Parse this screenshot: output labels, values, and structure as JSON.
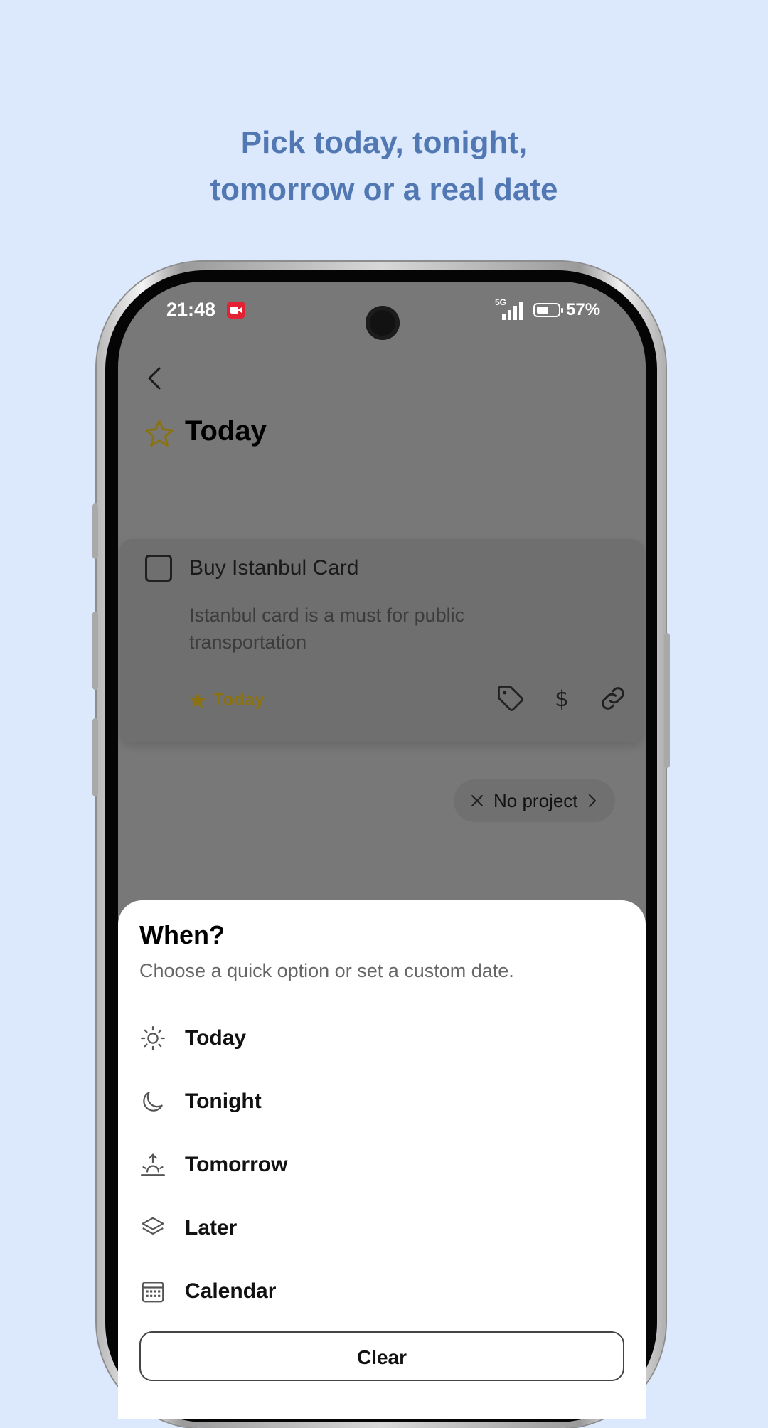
{
  "headline": {
    "line1": "Pick today, tonight,",
    "line2": "tomorrow or a real date"
  },
  "status_bar": {
    "time": "21:48",
    "network": "5G",
    "battery": "57%",
    "battery_level": 0.57
  },
  "page": {
    "title": "Today"
  },
  "task": {
    "title": "Buy Istanbul Card",
    "description": "Istanbul card is a must for public transportation",
    "when_label": "Today"
  },
  "project_chip": {
    "label": "No project"
  },
  "sheet": {
    "title": "When?",
    "subtitle": "Choose a quick option or set a custom date.",
    "options": [
      {
        "label": "Today",
        "icon": "sun-icon"
      },
      {
        "label": "Tonight",
        "icon": "moon-icon"
      },
      {
        "label": "Tomorrow",
        "icon": "sunrise-icon"
      },
      {
        "label": "Later",
        "icon": "layers-icon"
      },
      {
        "label": "Calendar",
        "icon": "calendar-icon"
      }
    ],
    "clear_label": "Clear"
  },
  "colors": {
    "background": "#dce8fb",
    "headline": "#5178b3",
    "accent_gold": "#8a7212",
    "overlay": "#787878"
  }
}
